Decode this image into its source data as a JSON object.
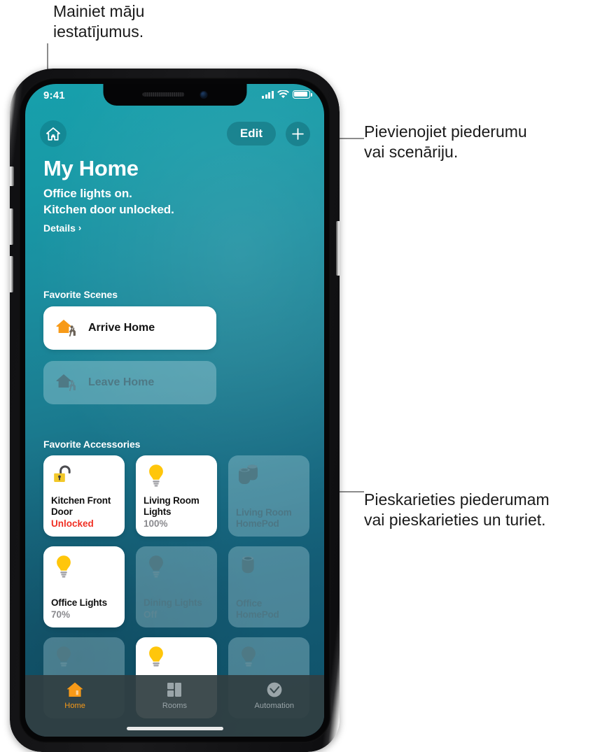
{
  "callouts": {
    "settings": "Mainiet māju\niestatījumus.",
    "add": "Pievienojiet piederumu\nvai scenāriju.",
    "touch": "Pieskarieties piederumam\nvai pieskarieties un turiet."
  },
  "status_bar": {
    "time": "9:41",
    "signal_icon": "cellular-signal-icon",
    "wifi_icon": "wifi-icon",
    "battery_icon": "battery-full-icon"
  },
  "header": {
    "home_icon": "home-icon",
    "edit_label": "Edit",
    "add_icon": "plus-icon"
  },
  "title": {
    "home_name": "My Home",
    "status_lines": [
      "Office lights on.",
      "Kitchen door unlocked."
    ],
    "details_label": "Details",
    "details_chevron": "›"
  },
  "sections": {
    "scenes_heading": "Favorite Scenes",
    "accessories_heading": "Favorite Accessories"
  },
  "scenes": [
    {
      "label": "Arrive Home",
      "state": "on",
      "icon": "house-arrive-icon"
    },
    {
      "label": "Leave Home",
      "state": "off",
      "icon": "house-leave-icon"
    }
  ],
  "accessories": [
    {
      "name": "Kitchen\nFront Door",
      "state": "Unlocked",
      "alert": true,
      "on": true,
      "icon": "unlocked-padlock-icon"
    },
    {
      "name": "Living Room\nLights",
      "state": "100%",
      "alert": false,
      "on": true,
      "icon": "lightbulb-icon"
    },
    {
      "name": "Living Room\nHomePod",
      "state": "",
      "alert": false,
      "on": false,
      "icon": "homepod-stereo-icon"
    },
    {
      "name": "Office\nLights",
      "state": "70%",
      "alert": false,
      "on": true,
      "icon": "lightbulb-icon"
    },
    {
      "name": "Dining\nLights",
      "state": "Off",
      "alert": false,
      "on": false,
      "icon": "lightbulb-icon"
    },
    {
      "name": "Office\nHomePod",
      "state": "",
      "alert": false,
      "on": false,
      "icon": "homepod-icon"
    },
    {
      "name": "",
      "state": "",
      "alert": false,
      "on": false,
      "icon": "lightbulb-icon"
    },
    {
      "name": "",
      "state": "",
      "alert": false,
      "on": true,
      "icon": "lightbulb-icon"
    },
    {
      "name": "",
      "state": "",
      "alert": false,
      "on": false,
      "icon": "lightbulb-icon"
    }
  ],
  "tabs": [
    {
      "label": "Home",
      "icon": "home-filled-icon",
      "active": true
    },
    {
      "label": "Rooms",
      "icon": "rooms-grid-icon",
      "active": false
    },
    {
      "label": "Automation",
      "icon": "automation-clock-icon",
      "active": false
    }
  ],
  "colors": {
    "accent_orange": "#f79a18",
    "alert_red": "#f03024",
    "bulb_yellow": "#ffc60b",
    "screen_top": "#17a0ac",
    "screen_bottom": "#0f5069"
  }
}
